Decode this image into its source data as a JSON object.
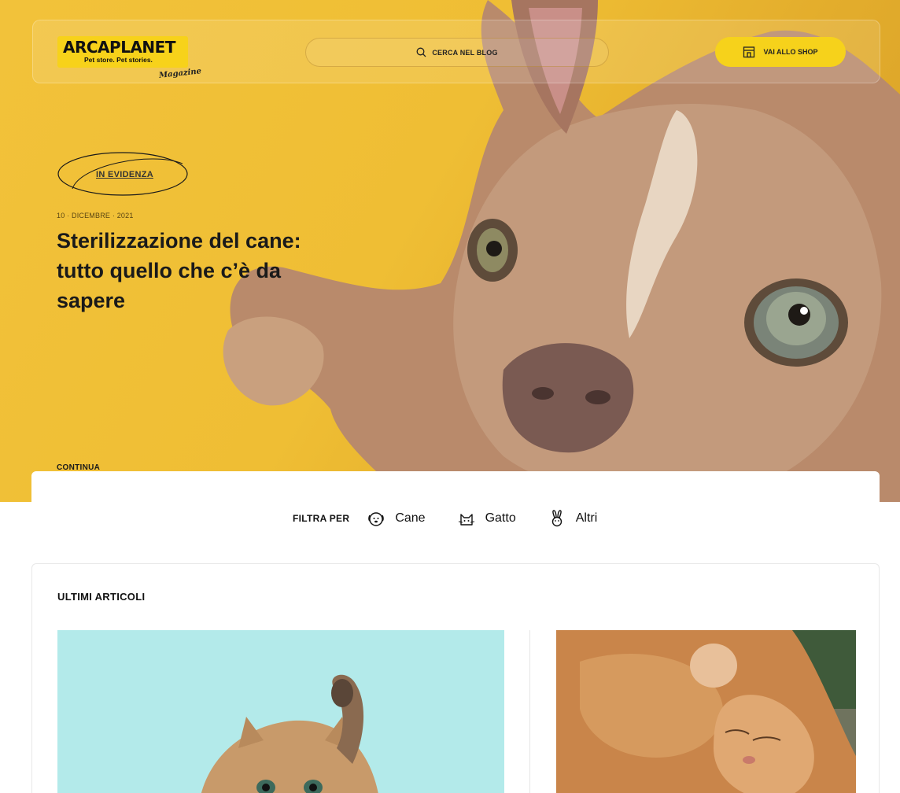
{
  "header": {
    "logo_text": "ARCAPLANET",
    "logo_tagline": "Pet store. Pet stories.",
    "logo_magazine": "Magazine",
    "search_label": "CERCA NEL BLOG",
    "shop_button": "VAI ALLO SHOP"
  },
  "hero": {
    "badge": "IN EVIDENZA",
    "date": "10 · DICEMBRE · 2021",
    "title": "Sterilizzazione del cane: tutto quello che c’è da sapere",
    "cta": "CONTINUA"
  },
  "filter": {
    "label": "FILTRA PER",
    "options": [
      {
        "label": "Cane",
        "icon": "dog-icon"
      },
      {
        "label": "Gatto",
        "icon": "cat-icon"
      },
      {
        "label": "Altri",
        "icon": "rabbit-icon"
      }
    ]
  },
  "articles": {
    "title": "ULTIMI ARTICOLI"
  },
  "colors": {
    "brand_yellow": "#f6d21b",
    "hero_yellow": "#efbe34"
  }
}
